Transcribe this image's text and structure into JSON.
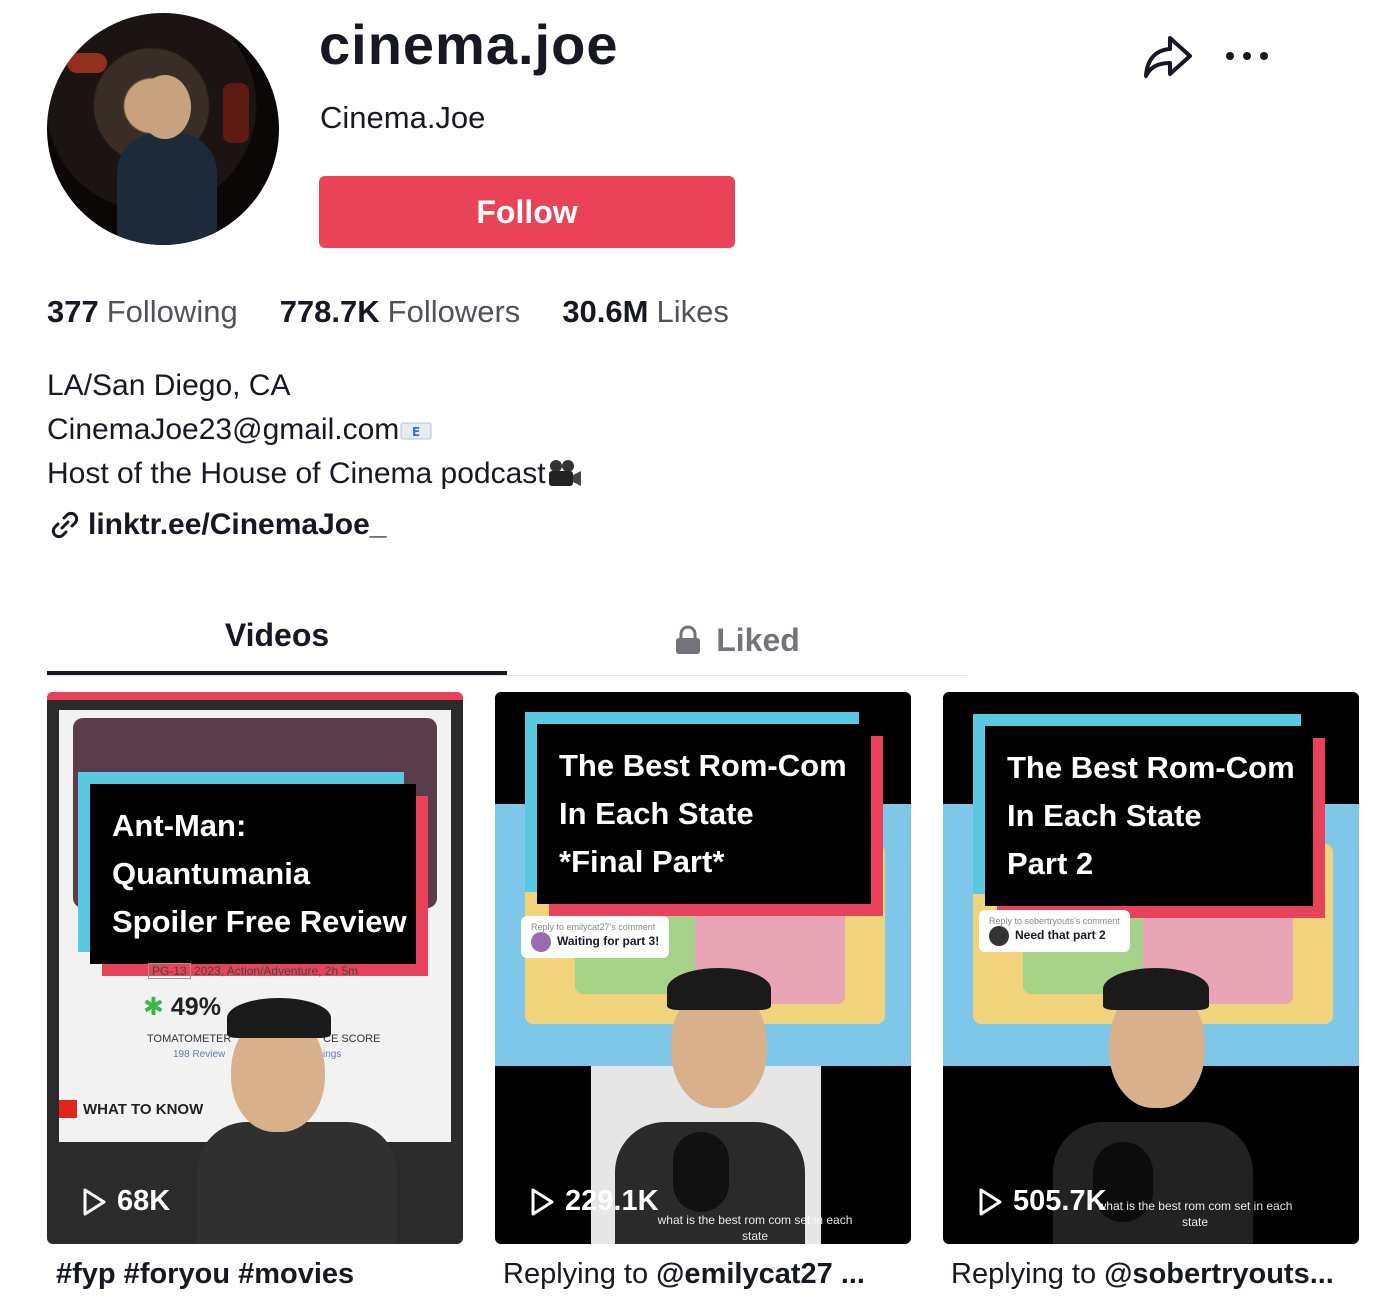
{
  "profile": {
    "handle": "cinema.joe",
    "nickname": "Cinema.Joe",
    "follow_label": "Follow"
  },
  "stats": [
    {
      "value": "377",
      "label": "Following"
    },
    {
      "value": "778.7K",
      "label": "Followers"
    },
    {
      "value": "30.6M",
      "label": "Likes"
    }
  ],
  "bio": {
    "line1": "LA/San Diego, CA",
    "line2": "CinemaJoe23@gmail.com",
    "line3": "Host of the House of Cinema podcast",
    "link": "linktr.ee/CinemaJoe_"
  },
  "tabs": {
    "videos": "Videos",
    "liked": "Liked"
  },
  "videos": [
    {
      "title_lines": [
        "Ant-Man:",
        "Quantumania",
        "Spoiler Free Review"
      ],
      "views": "68K",
      "caption": "#fyp #foryou #movies",
      "overlay": {
        "rating": "PG-13",
        "meta": "2023, Action/Adventure, 2h 5m",
        "score": "49%",
        "tomatometer": "TOMATOMETER",
        "reviews": "198 Review",
        "audience": "CE SCORE",
        "ratings": "ings",
        "what_to_know": "WHAT TO KNOW"
      }
    },
    {
      "title_lines": [
        "The Best Rom-Com",
        "In Each State",
        "*Final Part*"
      ],
      "views": "229.1K",
      "caption_prefix": "Replying to ",
      "caption_mention": "@emilycat27 ...",
      "reply": {
        "small": "Reply to emilycat27's comment",
        "text": "Waiting for part 3!"
      },
      "subtitle": "what is the best rom com set in each state"
    },
    {
      "title_lines": [
        "The Best Rom-Com",
        "In Each State",
        "Part 2"
      ],
      "views": "505.7K",
      "caption_prefix": "Replying to ",
      "caption_mention": "@sobertryouts...",
      "reply": {
        "small": "Reply to sobertryouts's comment",
        "text": "Need that part 2"
      },
      "subtitle": "what is the best rom com set in each state"
    }
  ],
  "colors": {
    "follow": "#ea4359",
    "cyan": "#5ac8e0",
    "red": "#e8435a",
    "text": "#161823"
  },
  "icons": [
    "share-icon",
    "more-icon",
    "link-icon",
    "lock-icon",
    "play-icon",
    "envelope-emoji",
    "movie-camera-emoji"
  ]
}
